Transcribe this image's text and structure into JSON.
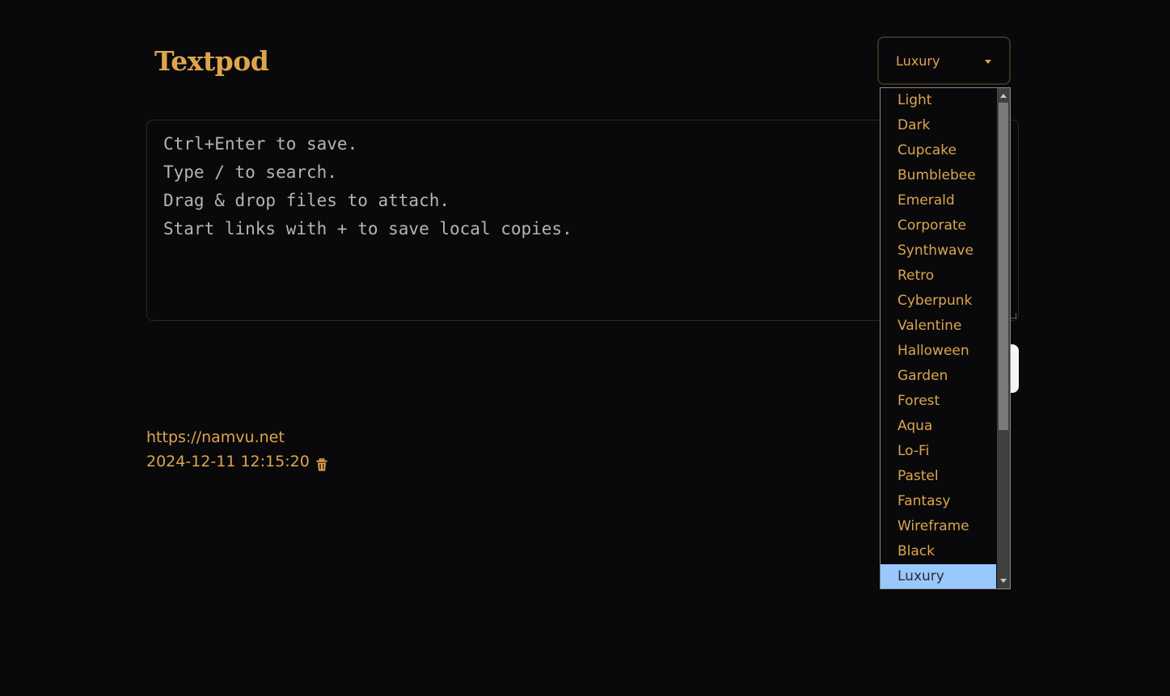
{
  "app": {
    "title": "Textpod"
  },
  "theme_select": {
    "value": "Luxury",
    "options": [
      "Light",
      "Dark",
      "Cupcake",
      "Bumblebee",
      "Emerald",
      "Corporate",
      "Synthwave",
      "Retro",
      "Cyberpunk",
      "Valentine",
      "Halloween",
      "Garden",
      "Forest",
      "Aqua",
      "Lo-Fi",
      "Pastel",
      "Fantasy",
      "Wireframe",
      "Black",
      "Luxury"
    ]
  },
  "editor": {
    "placeholder_lines": [
      "Ctrl+Enter to save.",
      "Type / to search.",
      "Drag & drop files to attach.",
      "Start links with + to save local copies."
    ]
  },
  "notes": [
    {
      "content": "https://namvu.net",
      "timestamp": "2024-12-11 12:15:20",
      "delete_icon": "trash-icon"
    }
  ],
  "colors": {
    "accent": "#dca54c",
    "background": "#09090b",
    "selected_option_bg": "#99c8ff"
  }
}
